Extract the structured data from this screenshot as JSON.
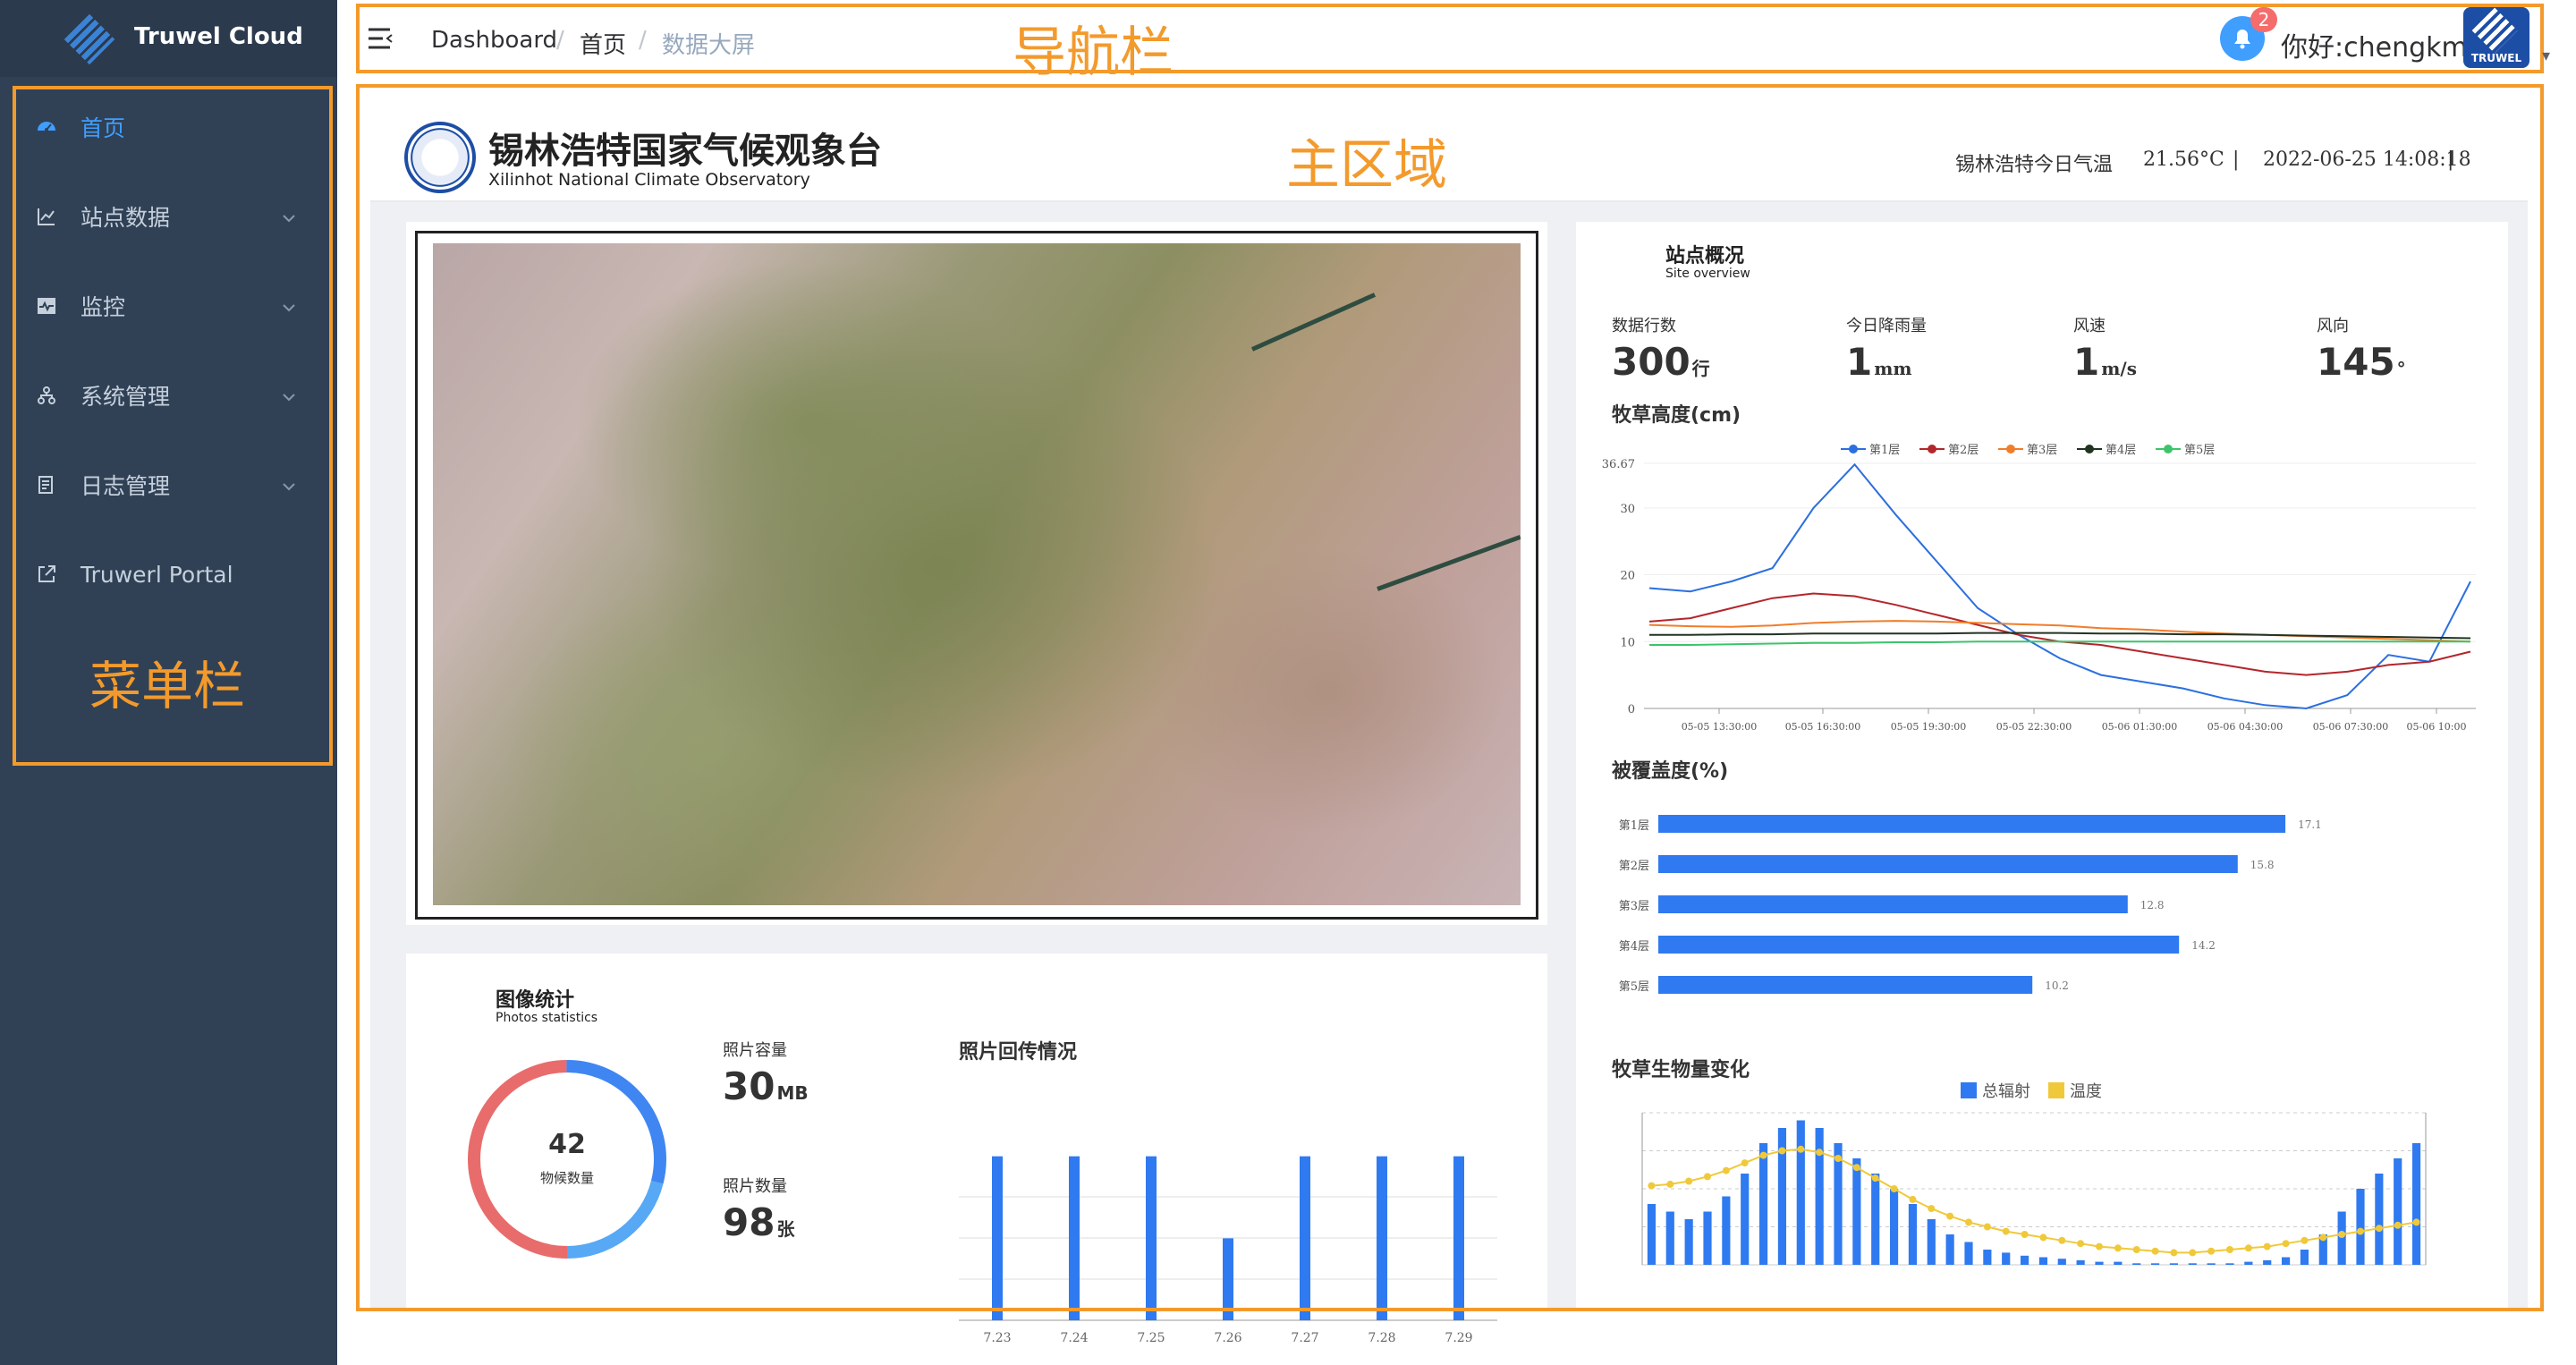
{
  "sidebar": {
    "brand": "Truwel Cloud",
    "items": [
      {
        "label": "首页",
        "icon": "dashboard-icon",
        "active": true
      },
      {
        "label": "站点数据",
        "icon": "line-chart-icon"
      },
      {
        "label": "监控",
        "icon": "monitor-icon"
      },
      {
        "label": "系统管理",
        "icon": "tree-icon"
      },
      {
        "label": "日志管理",
        "icon": "log-icon"
      },
      {
        "label": "Truwerl Portal",
        "icon": "external-link-icon"
      }
    ],
    "caption": "菜单栏"
  },
  "navbar": {
    "breadcrumb": [
      "Dashboard",
      "首页",
      "数据大屏"
    ],
    "separator": "/",
    "caption": "导航栏",
    "notification_count": "2",
    "greeting": "你好:chengkm",
    "avatar_text": "TRUWEL"
  },
  "main": {
    "caption": "主区域",
    "observatory_title": "锡林浩特国家气候观象台",
    "observatory_subtitle": "Xilinhot National Climate Observatory",
    "weather_label": "锡林浩特今日气温",
    "temperature": "21.56°C",
    "datetime": "2022-06-25 14:08:18",
    "divider": "|"
  },
  "photo_stats": {
    "title": "图像统计",
    "subtitle": "Photos statistics",
    "donut_value": "42",
    "donut_label": "物候数量",
    "capacity_label": "照片容量",
    "capacity_value": "30",
    "capacity_unit": "MB",
    "count_label": "照片数量",
    "count_value": "98",
    "count_unit": "张",
    "upload_title": "照片回传情况"
  },
  "site": {
    "title": "站点概况",
    "subtitle": "Site overview",
    "stats": [
      {
        "label": "数据行数",
        "value": "300",
        "unit": "行"
      },
      {
        "label": "今日降雨量",
        "value": "1",
        "unit": "mm"
      },
      {
        "label": "风速",
        "value": "1",
        "unit": "m/s"
      },
      {
        "label": "风向",
        "value": "145",
        "unit": "°"
      }
    ],
    "grass_height_title": "牧草高度(cm)",
    "coverage_title": "被覆盖度(%)",
    "biomass_title": "牧草生物量变化"
  },
  "colors": {
    "accent": "#409eff",
    "frame": "#f39a2c",
    "sidebar": "#304156",
    "bar": "#2f7af0",
    "gold": "#f0c93a"
  },
  "chart_data": [
    {
      "type": "bar",
      "title": "照片回传情况",
      "categories": [
        "7.23",
        "7.24",
        "7.25",
        "7.26",
        "7.27",
        "7.28",
        "7.29"
      ],
      "values": [
        10,
        10,
        10,
        5,
        10,
        10,
        10
      ],
      "color": "#2f7af0",
      "grid": true
    },
    {
      "type": "line",
      "title": "牧草高度(cm)",
      "x": [
        "05-05 13:30:00",
        "05-05 16:30:00",
        "05-05 19:30:00",
        "05-05 22:30:00",
        "05-06 01:30:00",
        "05-06 04:30:00",
        "05-06 07:30:00",
        "05-06 10:00"
      ],
      "ylim": [
        0,
        36.67
      ],
      "yticks": [
        0,
        10,
        20,
        30,
        36.67
      ],
      "legend_position": "top",
      "series": [
        {
          "name": "第1层",
          "color": "#2b6fe0",
          "values": [
            18,
            17.5,
            19,
            21,
            30,
            36.5,
            29,
            22,
            15,
            11,
            7.5,
            5,
            4,
            3,
            1.5,
            0.5,
            0,
            2,
            8,
            7,
            19
          ]
        },
        {
          "name": "第2层",
          "color": "#b3262b",
          "values": [
            13,
            13.5,
            15,
            16.5,
            17.2,
            16.8,
            15.5,
            14,
            12.5,
            11,
            10,
            9.5,
            8.5,
            7.5,
            6.5,
            5.5,
            5,
            5.5,
            6.5,
            7,
            8.5
          ]
        },
        {
          "name": "第3层",
          "color": "#f07d2a",
          "values": [
            12.5,
            12.3,
            12.2,
            12.4,
            12.8,
            13,
            13.1,
            13,
            12.8,
            12.6,
            12.4,
            12,
            11.8,
            11.5,
            11.2,
            11,
            10.8,
            10.6,
            10.4,
            10.2,
            10
          ]
        },
        {
          "name": "第4层",
          "color": "#223322",
          "values": [
            11,
            11,
            11.1,
            11.1,
            11.2,
            11.2,
            11.2,
            11.2,
            11.3,
            11.3,
            11.3,
            11.2,
            11.2,
            11.1,
            11.1,
            11,
            10.9,
            10.8,
            10.7,
            10.6,
            10.5
          ]
        },
        {
          "name": "第5层",
          "color": "#3dc46b",
          "values": [
            9.5,
            9.5,
            9.6,
            9.7,
            9.8,
            9.8,
            9.9,
            9.9,
            10,
            10,
            10,
            10,
            10,
            10,
            10,
            10,
            10,
            10,
            10,
            10,
            10
          ]
        }
      ]
    },
    {
      "type": "bar",
      "title": "被覆盖度(%)",
      "orientation": "horizontal",
      "categories": [
        "第1层",
        "第2层",
        "第3层",
        "第4层",
        "第5层"
      ],
      "values": [
        17.1,
        15.8,
        12.8,
        14.2,
        10.2
      ],
      "color": "#2f7af0"
    },
    {
      "type": "bar",
      "title": "牧草生物量变化",
      "legend_position": "top",
      "series": [
        {
          "name": "总辐射",
          "type": "bar",
          "color": "#2f7af0",
          "values": [
            40,
            35,
            30,
            35,
            45,
            60,
            80,
            90,
            95,
            90,
            80,
            70,
            60,
            50,
            40,
            30,
            20,
            15,
            10,
            8,
            6,
            5,
            4,
            3,
            2,
            2,
            1,
            1,
            1,
            1,
            1,
            1,
            2,
            3,
            5,
            10,
            20,
            35,
            50,
            60,
            70,
            80
          ]
        },
        {
          "name": "温度",
          "type": "line",
          "color": "#f0c93a",
          "values": [
            52,
            53,
            55,
            58,
            62,
            67,
            72,
            75,
            76,
            74,
            70,
            64,
            57,
            50,
            43,
            37,
            32,
            28,
            25,
            22,
            20,
            18,
            16,
            14,
            12,
            11,
            10,
            9,
            8,
            8,
            9,
            10,
            11,
            12,
            14,
            16,
            18,
            20,
            22,
            24,
            26,
            28
          ]
        }
      ]
    }
  ]
}
